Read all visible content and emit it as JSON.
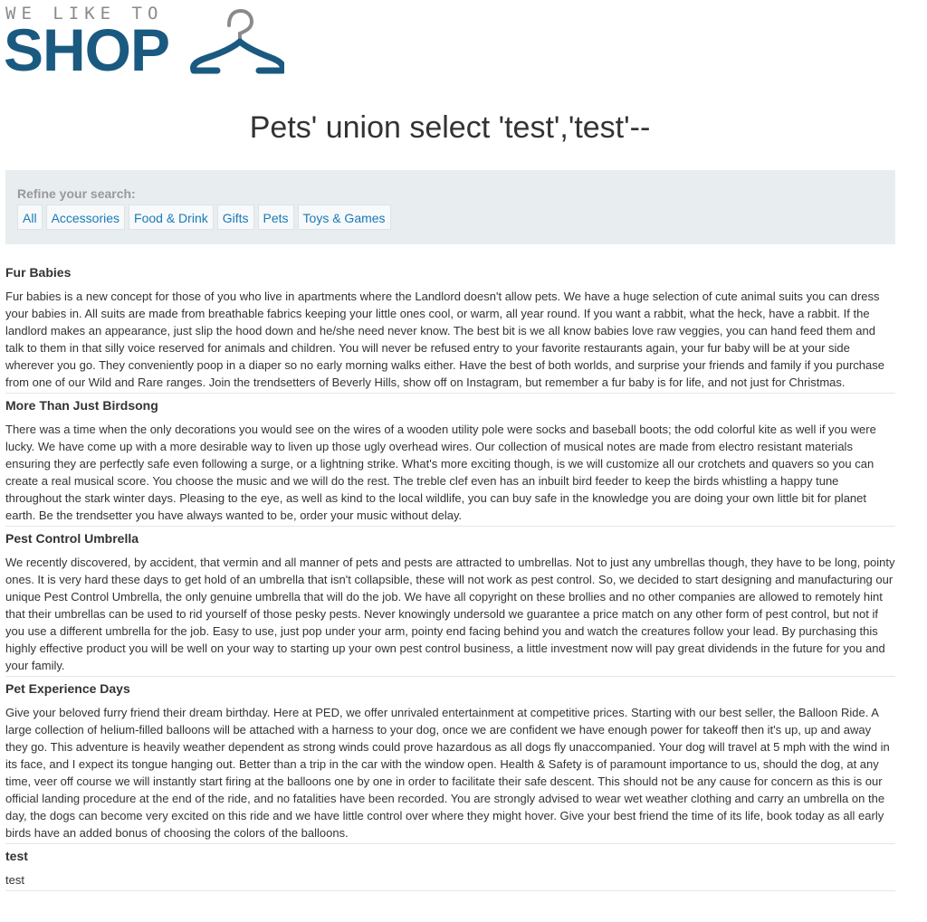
{
  "logo": {
    "tagline": "WE LIKE TO",
    "brand": "SHOP"
  },
  "page_title": "Pets' union select 'test','test'--",
  "filter": {
    "label": "Refine your search:",
    "categories": [
      "All",
      "Accessories",
      "Food & Drink",
      "Gifts",
      "Pets",
      "Toys & Games"
    ]
  },
  "posts": [
    {
      "title": "Fur Babies",
      "body": "Fur babies is a new concept for those of you who live in apartments where the Landlord doesn't allow pets. We have a huge selection of cute animal suits you can dress your babies in. All suits are made from breathable fabrics keeping your little ones cool, or warm, all year round. If you want a rabbit, what the heck, have a rabbit. If the landlord makes an appearance, just slip the hood down and he/she need never know. The best bit is we all know babies love raw veggies, you can hand feed them and talk to them in that silly voice reserved for animals and children. You will never be refused entry to your favorite restaurants again, your fur baby will be at your side wherever you go. They conveniently poop in a diaper so no early morning walks either. Have the best of both worlds, and surprise your friends and family if you purchase from one of our Wild and Rare ranges. Join the trendsetters of Beverly Hills, show off on Instagram, but remember a fur baby is for life, and not just for Christmas."
    },
    {
      "title": "More Than Just Birdsong",
      "body": "There was a time when the only decorations you would see on the wires of a wooden utility pole were socks and baseball boots; the odd colorful kite as well if you were lucky. We have come up with a more desirable way to liven up those ugly overhead wires. Our collection of musical notes are made from electro resistant materials ensuring they are perfectly safe even following a surge, or a lightning strike. What's more exciting though, is we will customize all our crotchets and quavers so you can create a real musical score. You choose the music and we will do the rest. The treble clef even has an inbuilt bird feeder to keep the birds whistling a happy tune throughout the stark winter days. Pleasing to the eye, as well as kind to the local wildlife, you can buy safe in the knowledge you are doing your own little bit for planet earth. Be the trendsetter you have always wanted to be, order your music without delay."
    },
    {
      "title": "Pest Control Umbrella",
      "body": "We recently discovered, by accident, that vermin and all manner of pets and pests are attracted to umbrellas. Not to just any umbrellas though, they have to be long, pointy ones. It is very hard these days to get hold of an umbrella that isn't collapsible, these will not work as pest control. So, we decided to start designing and manufacturing our unique Pest Control Umbrella, the only genuine umbrella that will do the job. We have all copyright on these brollies and no other companies are allowed to remotely hint that their umbrellas can be used to rid yourself of those pesky pests. Never knowingly undersold we guarantee a price match on any other form of pest control, but not if you use a different umbrella for the job. Easy to use, just pop under your arm, pointy end facing behind you and watch the creatures follow your lead. By purchasing this highly effective product you will be well on your way to starting up your own pest control business, a little investment now will pay great dividends in the future for you and your family."
    },
    {
      "title": "Pet Experience Days",
      "body": "Give your beloved furry friend their dream birthday. Here at PED, we offer unrivaled entertainment at competitive prices. Starting with our best seller, the Balloon Ride. A large collection of helium-filled balloons will be attached with a harness to your dog, once we are confident we have enough power for takeoff then it's up, up and away they go. This adventure is heavily weather dependent as strong winds could prove hazardous as all dogs fly unaccompanied. Your dog will travel at 5 mph with the wind in its face, and I expect its tongue hanging out. Better than a trip in the car with the window open. Health & Safety is of paramount importance to us, should the dog, at any time, veer off course we will instantly start firing at the balloons one by one in order to facilitate their safe descent. This should not be any cause for concern as this is our official landing procedure at the end of the ride, and no fatalities have been recorded. You are strongly advised to wear wet weather clothing and carry an umbrella on the day, the dogs can become very excited on this ride and we have little control over where they might hover. Give your best friend the time of its life, book today as all early birds have an added bonus of choosing the colors of the balloons."
    },
    {
      "title": "test",
      "body": "test"
    }
  ],
  "colors": {
    "brand_blue": "#1a5a80",
    "link_blue": "#1a7ab8",
    "filter_bg": "#e8edf0",
    "hanger_gray": "#8a8a8a"
  }
}
